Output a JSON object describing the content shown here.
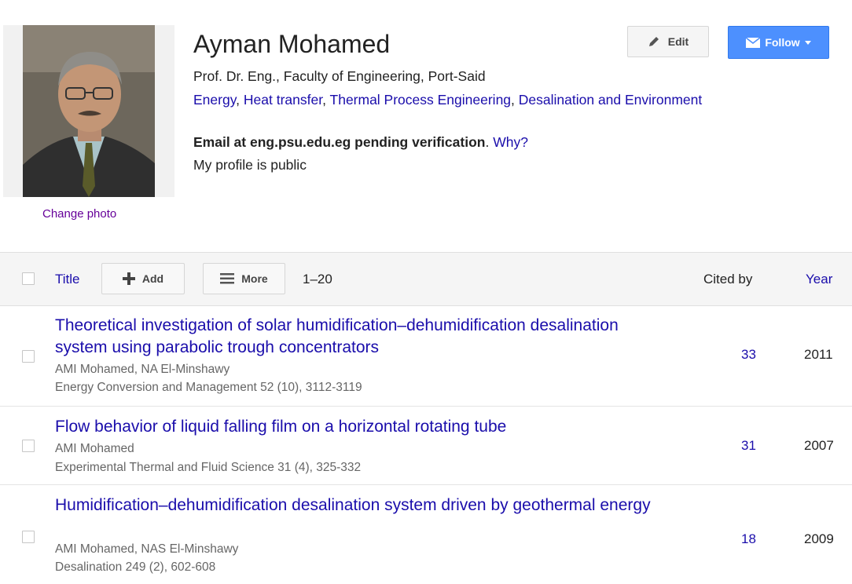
{
  "profile": {
    "name": "Ayman Mohamed",
    "affiliation": "Prof. Dr. Eng., Faculty of Engineering, Port-Said",
    "interests": [
      "Energy",
      "Heat transfer",
      "Thermal Process Engineering",
      "Desalination and Environment"
    ],
    "email_status": "Email at eng.psu.edu.eg pending verification",
    "email_why": "Why?",
    "visibility": "My profile is public",
    "change_photo_label": "Change photo"
  },
  "actions": {
    "edit_label": "Edit",
    "follow_label": "Follow",
    "accent_color": "#4d90fe"
  },
  "table": {
    "title_header": "Title",
    "add_label": "Add",
    "more_label": "More",
    "range": "1–20",
    "cited_by_header": "Cited by",
    "year_header": "Year",
    "articles": [
      {
        "title": "Theoretical investigation of solar humidification–dehumidification desalination system using parabolic trough concentrators",
        "authors": "AMI Mohamed, NA El-Minshawy",
        "venue": "Energy Conversion and Management 52 (10), 3112-3119",
        "cited_by": "33",
        "year": "2011"
      },
      {
        "title": "Flow behavior of liquid falling film on a horizontal rotating tube",
        "authors": "AMI Mohamed",
        "venue": "Experimental Thermal and Fluid Science 31 (4), 325-332",
        "cited_by": "31",
        "year": "2007"
      },
      {
        "title": "Humidification–dehumidification desalination system driven by geothermal energy",
        "authors": "AMI Mohamed, NAS El-Minshawy",
        "venue": "Desalination 249 (2), 602-608",
        "cited_by": "18",
        "year": "2009"
      }
    ]
  }
}
